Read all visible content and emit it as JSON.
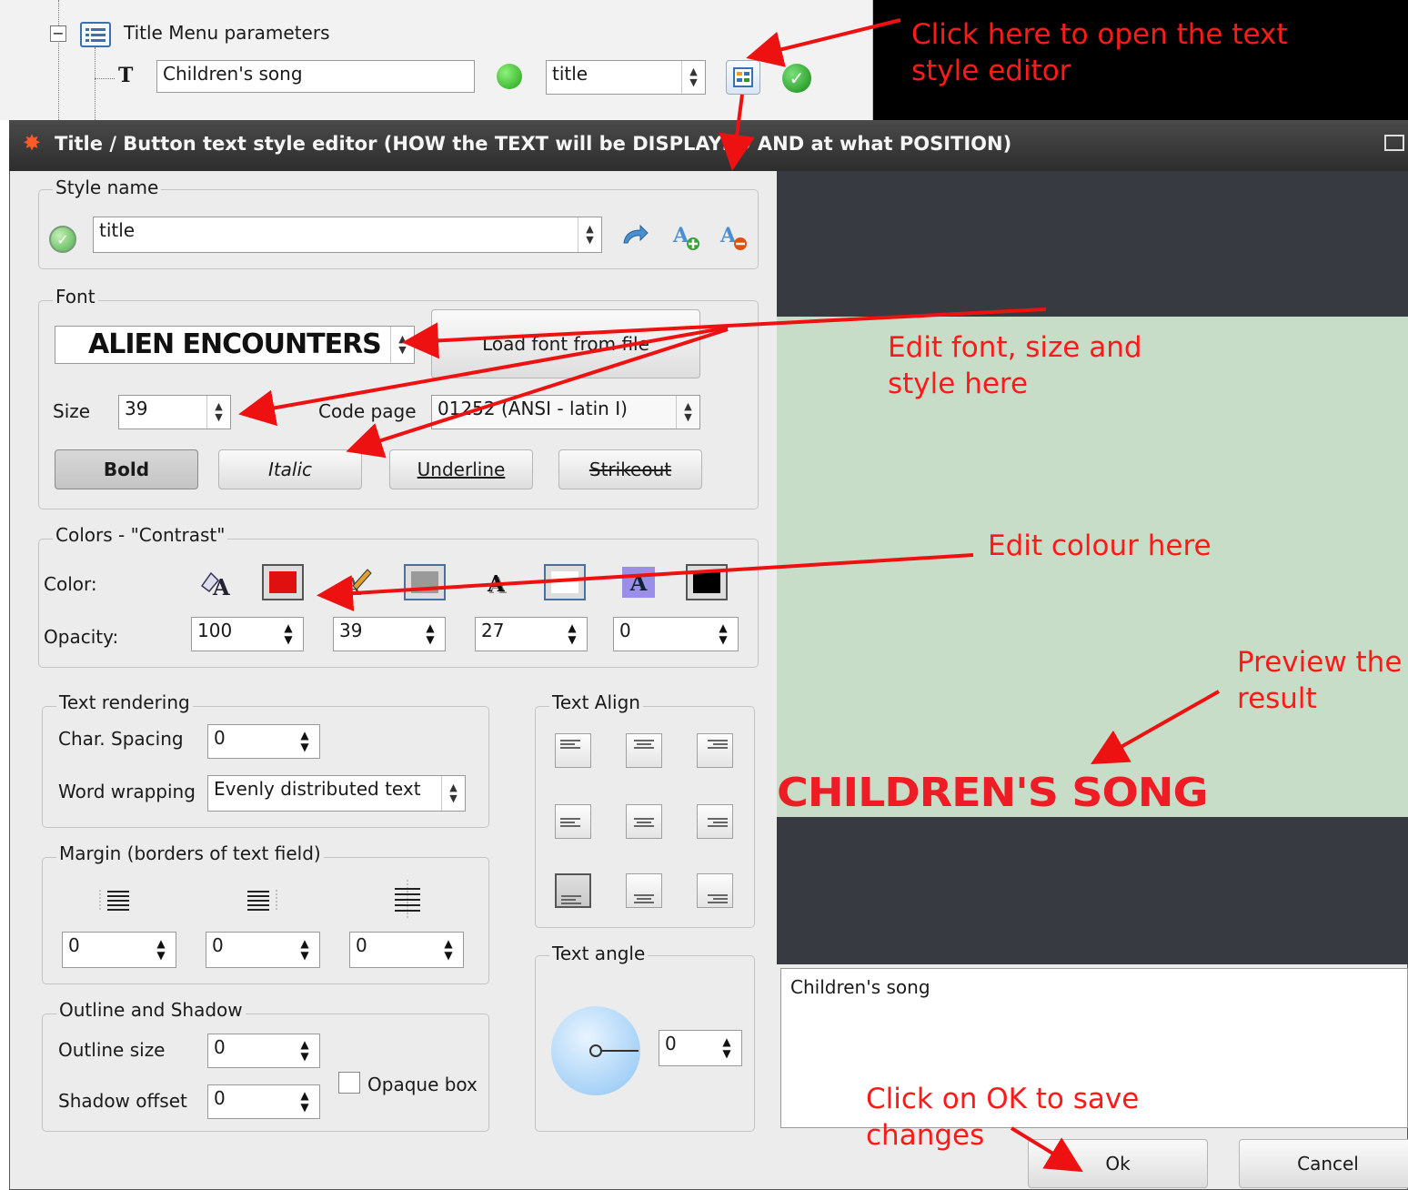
{
  "tree": {
    "node_label": "Title Menu parameters",
    "text_icon": "T",
    "text_value": "Children's song",
    "style_select": "title"
  },
  "dialog": {
    "title": "Title / Button text style editor  (HOW the TEXT will be DISPLAYED AND at what POSITION)",
    "style_name": {
      "group": "Style name",
      "value": "title"
    },
    "font": {
      "group": "Font",
      "font_name": "ALIEN ENCOUNTERS",
      "load_button": "Load font from file",
      "size_label": "Size",
      "size_value": "39",
      "codepage_label": "Code page",
      "codepage_value": "01252 (ANSI - latin I)",
      "bold": "Bold",
      "italic": "Italic",
      "underline": "Underline",
      "strikeout": "Strikeout"
    },
    "colors": {
      "group": "Colors - \"Contrast\"",
      "color_label": "Color:",
      "opacity_label": "Opacity:",
      "opacities": [
        "100",
        "39",
        "27",
        "0"
      ],
      "swatch_colors": [
        "#e01010",
        "#9a9a9a",
        "#ffffff",
        "#000000"
      ]
    },
    "rendering": {
      "group": "Text rendering",
      "spacing_label": "Char. Spacing",
      "spacing_value": "0",
      "wrap_label": "Word wrapping",
      "wrap_value": "Evenly distributed text"
    },
    "margin": {
      "group": "Margin  (borders of text field)",
      "values": [
        "0",
        "0",
        "0"
      ]
    },
    "outline": {
      "group": "Outline  and Shadow",
      "outline_label": "Outline size",
      "outline_value": "0",
      "shadow_label": "Shadow offset",
      "shadow_value": "0",
      "opaque_label": "Opaque box"
    },
    "align": {
      "group": "Text Align"
    },
    "angle": {
      "group": "Text angle",
      "value": "0"
    },
    "preview_text": "CHILDREN'S SONG",
    "editor_text": "Children's song",
    "ok": "Ok",
    "cancel": "Cancel"
  },
  "annotations": {
    "open_editor_1": "Click here to open the text",
    "open_editor_2": "style editor",
    "font_1": "Edit font, size and",
    "font_2": "style here",
    "colour": "Edit colour here",
    "preview_1": "Preview the",
    "preview_2": "result",
    "ok_1": "Click on OK to save",
    "ok_2": "changes"
  }
}
